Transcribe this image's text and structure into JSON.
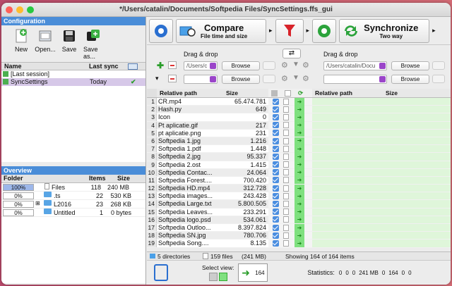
{
  "window": {
    "title": "*/Users/catalin/Documents/Softpedia Files/SyncSettings.ffs_gui"
  },
  "config": {
    "header": "Configuration",
    "tools": [
      {
        "label": "New",
        "icon": "new-icon"
      },
      {
        "label": "Open...",
        "icon": "open-icon"
      },
      {
        "label": "Save",
        "icon": "save-icon"
      },
      {
        "label": "Save as...",
        "icon": "save-as-icon"
      }
    ],
    "col_name": "Name",
    "col_lastsync": "Last sync",
    "rows": [
      {
        "name": "[Last session]",
        "lastsync": ""
      },
      {
        "name": "SyncSettings",
        "lastsync": "Today"
      }
    ]
  },
  "overview": {
    "header": "Overview",
    "col_folder": "Folder",
    "col_items": "Items",
    "col_size": "Size",
    "rows": [
      {
        "pct": "100%",
        "name": "Files",
        "items": "118",
        "size": "240 MB",
        "type": "file"
      },
      {
        "pct": "0%",
        "name": ".ts",
        "items": "22",
        "size": "530 KB",
        "type": "folder"
      },
      {
        "pct": "0%",
        "name": "L2016",
        "items": "23",
        "size": "268 KB",
        "type": "folder"
      },
      {
        "pct": "0%",
        "name": "Untitled",
        "items": "1",
        "size": "0 bytes",
        "type": "folder"
      }
    ]
  },
  "toolbar": {
    "compare_label": "Compare",
    "compare_sub": "File time and size",
    "sync_label": "Synchronize",
    "sync_sub": "Two way"
  },
  "folders": {
    "dragdrop_left": "Drag & drop",
    "dragdrop_right": "Drag & drop",
    "left_path": "/Users/c",
    "right_path": "/Users/catalin/Docu",
    "browse": "Browse"
  },
  "grid": {
    "col_relpath": "Relative path",
    "col_size": "Size",
    "rows": [
      {
        "n": "1",
        "name": "CR.mp4",
        "size": "65.474.781"
      },
      {
        "n": "2",
        "name": "Hash.py",
        "size": "649"
      },
      {
        "n": "3",
        "name": "Icon",
        "size": "0"
      },
      {
        "n": "4",
        "name": "Pt aplicatie.gif",
        "size": "217"
      },
      {
        "n": "5",
        "name": "pt aplicatie.png",
        "size": "231"
      },
      {
        "n": "6",
        "name": "Softpedia 1.jpg",
        "size": "1.216"
      },
      {
        "n": "7",
        "name": "Softpedia 1.pdf",
        "size": "1.448"
      },
      {
        "n": "8",
        "name": "Softpedia 2.jpg",
        "size": "95.337"
      },
      {
        "n": "9",
        "name": "Softpedia 2.ost",
        "size": "1.415"
      },
      {
        "n": "10",
        "name": "Softpedia Contac...",
        "size": "24.064"
      },
      {
        "n": "11",
        "name": "Softpedia Forest....",
        "size": "700.420"
      },
      {
        "n": "12",
        "name": "Softpedia HD.mp4",
        "size": "312.728"
      },
      {
        "n": "13",
        "name": "Softpedia images...",
        "size": "243.428"
      },
      {
        "n": "14",
        "name": "Softpedia Large.txt",
        "size": "5.800.505"
      },
      {
        "n": "15",
        "name": "Softpedia Leaves...",
        "size": "233.291"
      },
      {
        "n": "16",
        "name": "Softpedia logo.psd",
        "size": "534.061"
      },
      {
        "n": "17",
        "name": "Softpedia Outloo...",
        "size": "8.397.824"
      },
      {
        "n": "18",
        "name": "Softpedia SN.jpg",
        "size": "780.706"
      },
      {
        "n": "19",
        "name": "Softpedia Song....",
        "size": "8.135"
      }
    ]
  },
  "status": {
    "dirs": "5 directories",
    "files": "159 files",
    "size": "(241 MB)",
    "showing": "Showing 164 of 164 items"
  },
  "bottom": {
    "select_view": "Select view:",
    "count": "164",
    "statistics": "Statistics:",
    "stats": [
      "0",
      "0",
      "0",
      "241 MB",
      "0",
      "164",
      "0",
      "0"
    ]
  }
}
